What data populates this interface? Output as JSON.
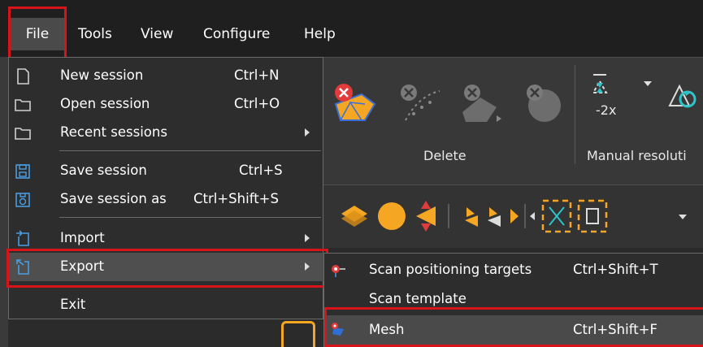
{
  "menubar": {
    "items": [
      "File",
      "Tools",
      "View",
      "Configure",
      "Help"
    ]
  },
  "file_menu": {
    "items": [
      {
        "label": "New session",
        "shortcut": "Ctrl+N",
        "icon": "new-file-icon"
      },
      {
        "label": "Open session",
        "shortcut": "Ctrl+O",
        "icon": "folder-icon"
      },
      {
        "label": "Recent sessions",
        "shortcut": "",
        "icon": "folder-icon",
        "submenu": true
      },
      {
        "label": "Save session",
        "shortcut": "Ctrl+S",
        "icon": "save-icon"
      },
      {
        "label": "Save session as",
        "shortcut": "Ctrl+Shift+S",
        "icon": "save-as-icon"
      },
      {
        "label": "Import",
        "shortcut": "",
        "icon": "import-icon",
        "submenu": true
      },
      {
        "label": "Export",
        "shortcut": "",
        "icon": "export-icon",
        "submenu": true,
        "active": true
      },
      {
        "label": "Exit",
        "shortcut": "",
        "icon": "",
        "submenu": false
      }
    ]
  },
  "export_submenu": {
    "items": [
      {
        "label": "Scan positioning targets",
        "shortcut": "Ctrl+Shift+T",
        "icon": "targets-icon"
      },
      {
        "label": "Scan template",
        "shortcut": "",
        "icon": ""
      },
      {
        "label": "Mesh",
        "shortcut": "Ctrl+Shift+F",
        "icon": "mesh-icon",
        "active": true
      }
    ]
  },
  "ribbon": {
    "delete_label": "Delete",
    "manual_resolution_label": "Manual resoluti",
    "resolution_value": "-2x"
  },
  "colors": {
    "accent_orange": "#f5a623",
    "highlight_red": "#d8141a",
    "menu_bg": "#2d2d2d",
    "active_bg": "#4f4f4f"
  }
}
